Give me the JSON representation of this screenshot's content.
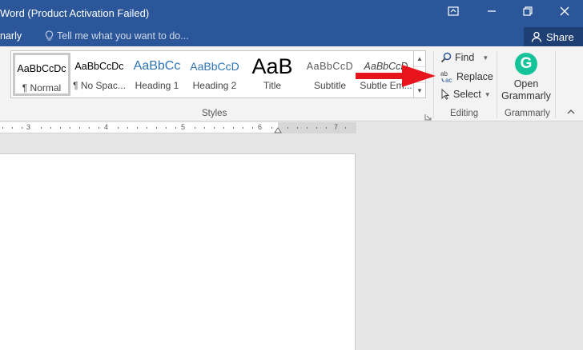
{
  "window": {
    "title": "Word (Product Activation Failed)",
    "controls": [
      "ribbon-display-icon",
      "minimize-icon",
      "restore-icon",
      "close-icon"
    ]
  },
  "tellbar": {
    "tab_fragment": "narly",
    "tell_me_placeholder": "Tell me what you want to do...",
    "share_label": "Share"
  },
  "styles": {
    "group_label": "Styles",
    "items": [
      {
        "preview": "AaBbCcDc",
        "name": "¶ Normal",
        "color": "#000000"
      },
      {
        "preview": "AaBbCcDc",
        "name": "¶ No Spac...",
        "color": "#000000"
      },
      {
        "preview": "AaBbCc",
        "name": "Heading 1",
        "color": "#2e74b5"
      },
      {
        "preview": "AaBbCcD",
        "name": "Heading 2",
        "color": "#2e74b5"
      },
      {
        "preview": "AaB",
        "name": "Title",
        "color": "#000000"
      },
      {
        "preview": "AaBbCcD",
        "name": "Subtitle",
        "color": "#595959"
      },
      {
        "preview": "AaBbCcD",
        "name": "Subtle Em...",
        "color": "#404040"
      }
    ]
  },
  "editing": {
    "group_label": "Editing",
    "find_label": "Find",
    "replace_label": "Replace",
    "select_label": "Select"
  },
  "grammarly": {
    "group_label": "Grammarly",
    "button_line1": "Open",
    "button_line2": "Grammarly",
    "logo_letter": "G",
    "color": "#15c39a"
  },
  "ruler": {
    "numbers": [
      "3",
      "4",
      "5",
      "6",
      "7"
    ]
  },
  "colors": {
    "titlebar": "#2b579a",
    "arrow": "#e8141b"
  }
}
